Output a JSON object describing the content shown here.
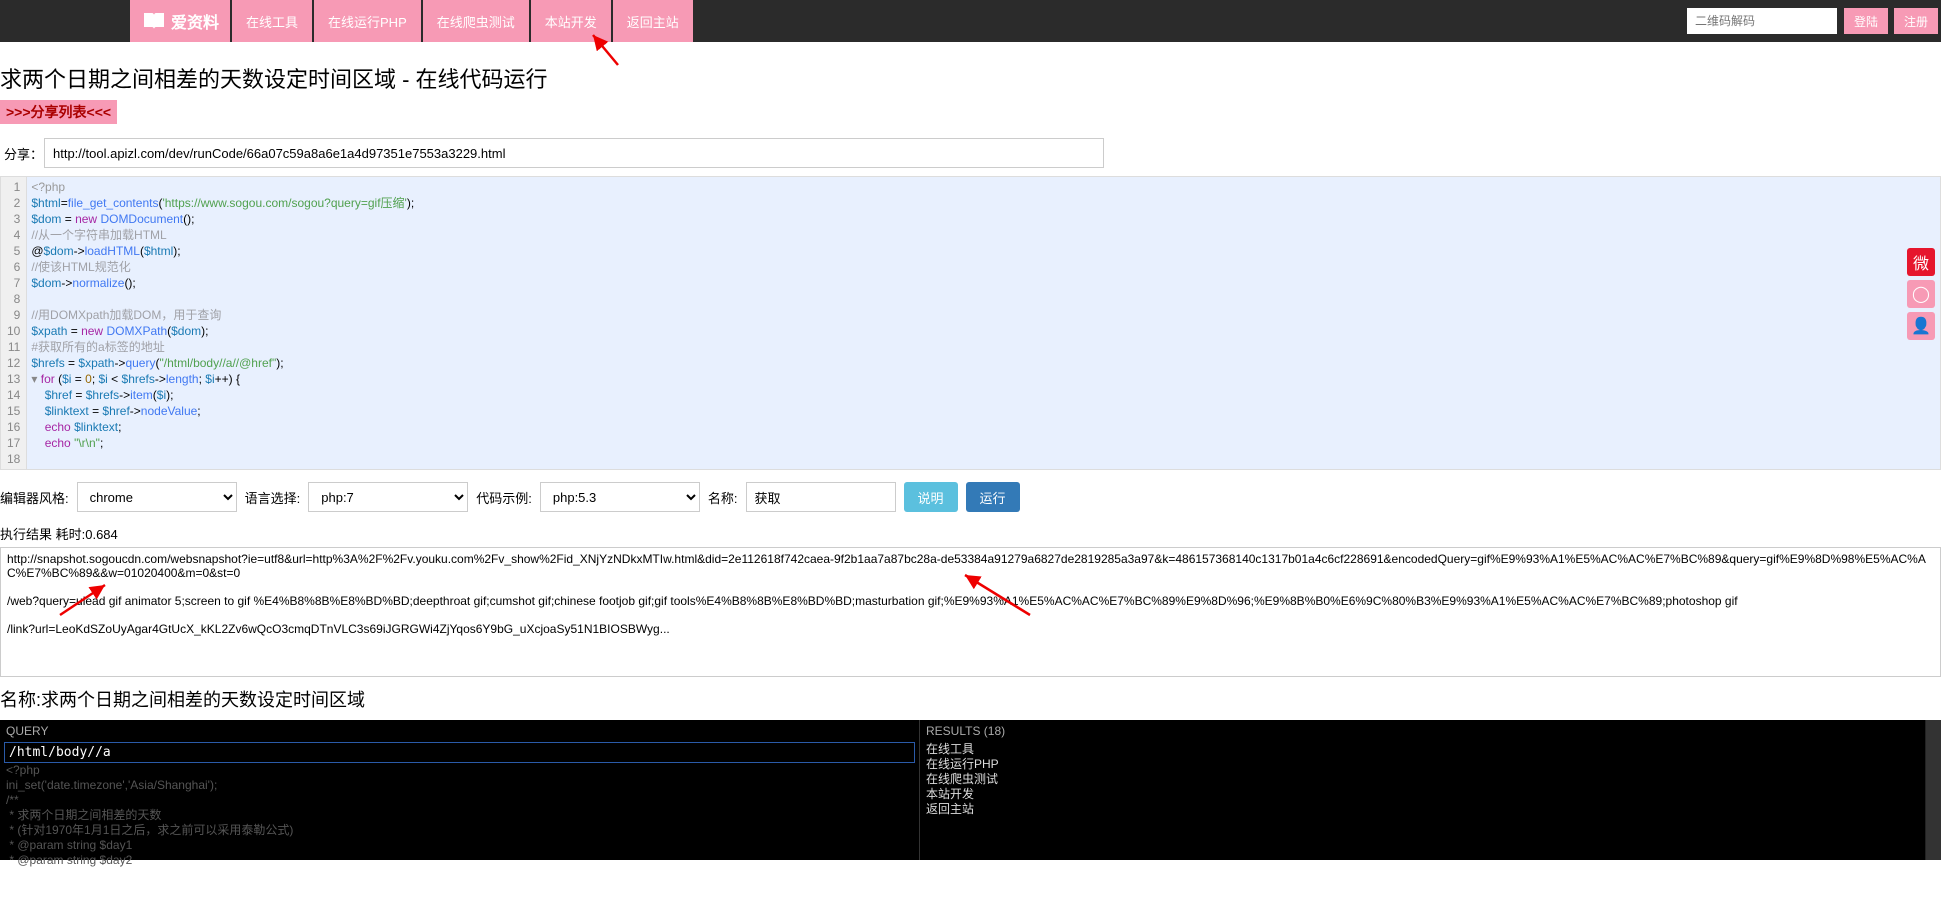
{
  "topbar": {
    "logo_text": "爱资料",
    "nav": [
      "在线工具",
      "在线运行PHP",
      "在线爬虫测试",
      "本站开发",
      "返回主站"
    ],
    "search_placeholder": "二维码解码",
    "login": "登陆",
    "register": "注册"
  },
  "page": {
    "title": "求两个日期之间相差的天数设定时间区域 - 在线代码运行",
    "share_list": ">>>分享列表<<<",
    "share_label": "分享：",
    "share_url": "http://tool.apizl.com/dev/runCode/66a07c59a8a6e1a4d97351e7553a3229.html"
  },
  "editor": {
    "lines": [
      {
        "n": 1,
        "html": "<span class='tk-php'>&lt;?php</span>"
      },
      {
        "n": 2,
        "html": "<span class='tk-var'>$html</span>=<span class='tk-fn'>file_get_contents</span>(<span class='tk-str'>'https://www.sogou.com/sogou?query=gif压缩'</span>);"
      },
      {
        "n": 3,
        "html": "<span class='tk-var'>$dom</span> = <span class='tk-kw'>new</span> <span class='tk-fn'>DOMDocument</span>();"
      },
      {
        "n": 4,
        "html": "<span class='tk-com'>//从一个字符串加载HTML</span>"
      },
      {
        "n": 5,
        "html": "@<span class='tk-var'>$dom</span>-&gt;<span class='tk-fn'>loadHTML</span>(<span class='tk-var'>$html</span>);"
      },
      {
        "n": 6,
        "html": "<span class='tk-com'>//使该HTML规范化</span>"
      },
      {
        "n": 7,
        "html": "<span class='tk-var'>$dom</span>-&gt;<span class='tk-fn'>normalize</span>();"
      },
      {
        "n": 8,
        "html": ""
      },
      {
        "n": 9,
        "html": "<span class='tk-com'>//用DOMXpath加载DOM，用于查询</span>"
      },
      {
        "n": 10,
        "html": "<span class='tk-var'>$xpath</span> = <span class='tk-kw'>new</span> <span class='tk-fn'>DOMXPath</span>(<span class='tk-var'>$dom</span>);"
      },
      {
        "n": 11,
        "html": "<span class='tk-com'>#获取所有的a标签的地址</span>"
      },
      {
        "n": 12,
        "html": "<span class='tk-var'>$hrefs</span> = <span class='tk-var'>$xpath</span>-&gt;<span class='tk-fn'>query</span>(<span class='tk-str'>\"/html/body//a//@href\"</span>);"
      },
      {
        "n": 13,
        "html": "<span class='fold'>▾</span> <span class='tk-kw'>for</span> (<span class='tk-var'>$i</span> = <span class='tk-num'>0</span>; <span class='tk-var'>$i</span> &lt; <span class='tk-var'>$hrefs</span>-&gt;<span class='tk-fn'>length</span>; <span class='tk-var'>$i</span>++) {"
      },
      {
        "n": 14,
        "html": "    <span class='tk-var'>$href</span> = <span class='tk-var'>$hrefs</span>-&gt;<span class='tk-fn'>item</span>(<span class='tk-var'>$i</span>);"
      },
      {
        "n": 15,
        "html": "    <span class='tk-var'>$linktext</span> = <span class='tk-var'>$href</span>-&gt;<span class='tk-fn'>nodeValue</span>;"
      },
      {
        "n": 16,
        "html": "    <span class='tk-kw'>echo</span> <span class='tk-var'>$linktext</span>;"
      },
      {
        "n": 17,
        "html": "    <span class='tk-kw'>echo</span> <span class='tk-str'>\"\\r\\n\"</span>;"
      },
      {
        "n": 18,
        "html": ""
      }
    ]
  },
  "toolbar": {
    "editor_style_label": "编辑器风格:",
    "editor_style_value": "chrome",
    "lang_label": "语言选择:",
    "lang_value": "php:7",
    "example_label": "代码示例:",
    "example_value": "php:5.3",
    "name_label": "名称:",
    "name_value": "获取",
    "explain_btn": "说明",
    "run_btn": "运行"
  },
  "result": {
    "label": "执行结果 耗时:0.684",
    "text": "http://snapshot.sogoucdn.com/websnapshot?ie=utf8&url=http%3A%2F%2Fv.youku.com%2Fv_show%2Fid_XNjYzNDkxMTIw.html&did=2e112618f742caea-9f2b1aa7a87bc28a-de53384a91279a6827de2819285a3a97&k=486157368140c1317b01a4c6cf228691&encodedQuery=gif%E9%93%A1%E5%AC%AC%E7%BC%89&query=gif%E9%8D%98%E5%AC%AC%E7%BC%89&&w=01020400&m=0&st=0\n\n/web?query=ulead gif animator 5;screen to gif %E4%B8%8B%E8%BD%BD;deepthroat gif;cumshot gif;chinese footjob gif;gif tools%E4%B8%8B%E8%BD%BD;masturbation gif;%E9%93%A1%E5%AC%AC%E7%BC%89%E9%8D%96;%E9%8B%B0%E6%9C%80%B3%E9%93%A1%E5%AC%AC%E7%BC%89;photoshop gif\n\n/link?url=LeoKdSZoUyAgar4GtUcX_kKL2Zv6wQcO3cmqDTnVLC3s69iJGRGWi4ZjYqos6Y9bG_uXcjoaSy51N1BIOSBWyg...",
    "name_line": "名称:求两个日期之间相差的天数设定时间区域"
  },
  "xpath_panel": {
    "query_header": "QUERY",
    "query_value": "/html/body//a",
    "bg_lines": [
      "<?php",
      "ini_set('date.timezone','Asia/Shanghai');",
      "/**",
      " * 求两个日期之间相差的天数",
      " * (针对1970年1月1日之后，求之前可以采用泰勒公式)",
      " * @param string $day1",
      " * @param string $day2"
    ],
    "results_header": "RESULTS (18)",
    "results": [
      "在线工具",
      "在线运行PHP",
      "在线爬虫测试",
      "本站开发",
      "返回主站"
    ]
  }
}
